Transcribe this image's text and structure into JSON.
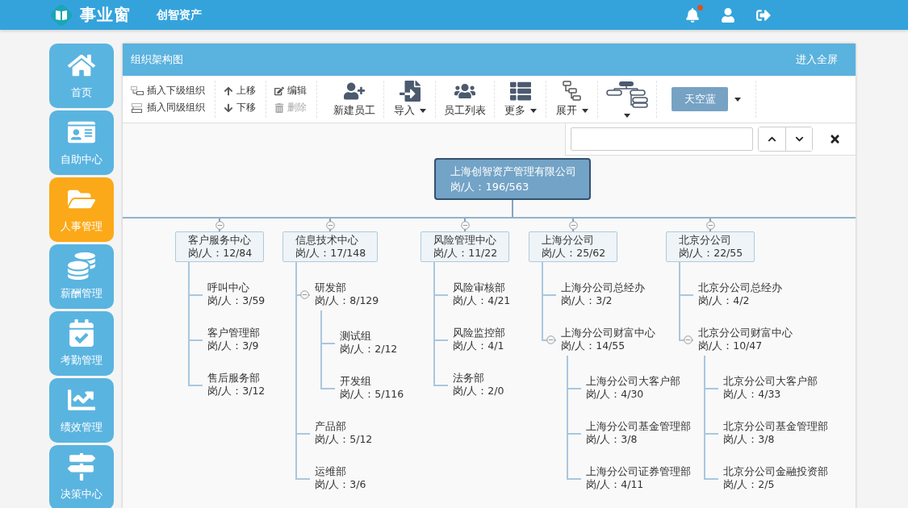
{
  "header": {
    "logo": "事业窗",
    "company": "创智资产",
    "notification_dot": true
  },
  "sidebar": {
    "items": [
      {
        "label": "首页",
        "selected": false
      },
      {
        "label": "自助中心",
        "selected": false
      },
      {
        "label": "人事管理",
        "selected": true
      },
      {
        "label": "薪酬管理",
        "selected": false
      },
      {
        "label": "考勤管理",
        "selected": false
      },
      {
        "label": "绩效管理",
        "selected": false
      },
      {
        "label": "决策中心",
        "selected": false
      }
    ]
  },
  "panel": {
    "title": "组织架构图",
    "fullscreen_link": "进入全屏"
  },
  "toolbar": {
    "small_groups": [
      [
        {
          "label": "插入下级组织",
          "disabled": false
        },
        {
          "label": "插入同级组织",
          "disabled": false
        }
      ],
      [
        {
          "label": "上移",
          "disabled": false
        },
        {
          "label": "下移",
          "disabled": false
        }
      ],
      [
        {
          "label": "编辑",
          "disabled": false
        },
        {
          "label": "删除",
          "disabled": true
        }
      ]
    ],
    "large_buttons": [
      {
        "label": "新建员工",
        "dropdown": false
      },
      {
        "label": "导入",
        "dropdown": true
      },
      {
        "label": "员工列表",
        "dropdown": false
      },
      {
        "label": "更多",
        "dropdown": true
      },
      {
        "label": "展开",
        "dropdown": true
      },
      {
        "dropdown": true
      }
    ],
    "theme_button": {
      "label": "天空蓝"
    }
  },
  "org_chart": {
    "root": {
      "name": "上海创智资产管理有限公司",
      "count": "岗/人：196/563"
    },
    "departments": [
      {
        "name": "客户服务中心",
        "count": "岗/人：12/84",
        "expanded": true,
        "children": [
          {
            "name": "呼叫中心",
            "count": "岗/人：3/59"
          },
          {
            "name": "客户管理部",
            "count": "岗/人：3/9"
          },
          {
            "name": "售后服务部",
            "count": "岗/人：3/12"
          }
        ]
      },
      {
        "name": "信息技术中心",
        "count": "岗/人：17/148",
        "expanded": true,
        "children": [
          {
            "name": "研发部",
            "count": "岗/人：8/129",
            "expanded": true,
            "children": [
              {
                "name": "测试组",
                "count": "岗/人：2/12"
              },
              {
                "name": "开发组",
                "count": "岗/人：5/116"
              }
            ]
          },
          {
            "name": "产品部",
            "count": "岗/人：5/12"
          },
          {
            "name": "运维部",
            "count": "岗/人：3/6"
          }
        ]
      },
      {
        "name": "风险管理中心",
        "count": "岗/人：11/22",
        "expanded": true,
        "children": [
          {
            "name": "风险审核部",
            "count": "岗/人：4/21"
          },
          {
            "name": "风险监控部",
            "count": "岗/人：4/1"
          },
          {
            "name": "法务部",
            "count": "岗/人：2/0"
          }
        ]
      },
      {
        "name": "上海分公司",
        "count": "岗/人：25/62",
        "expanded": true,
        "children": [
          {
            "name": "上海分公司总经办",
            "count": "岗/人：3/2"
          },
          {
            "name": "上海分公司财富中心",
            "count": "岗/人：14/55",
            "expanded": true,
            "children": [
              {
                "name": "上海分公司大客户部",
                "count": "岗/人：4/30"
              },
              {
                "name": "上海分公司基金管理部",
                "count": "岗/人：3/8"
              },
              {
                "name": "上海分公司证券管理部",
                "count": "岗/人：4/11"
              }
            ]
          }
        ]
      },
      {
        "name": "北京分公司",
        "count": "岗/人：22/55",
        "expanded": true,
        "children": [
          {
            "name": "北京分公司总经办",
            "count": "岗/人：4/2"
          },
          {
            "name": "北京分公司财富中心",
            "count": "岗/人：10/47",
            "expanded": true,
            "children": [
              {
                "name": "北京分公司大客户部",
                "count": "岗/人：4/33"
              },
              {
                "name": "北京分公司基金管理部",
                "count": "岗/人：3/8"
              },
              {
                "name": "北京分公司金融投资部",
                "count": "岗/人：2/5"
              }
            ]
          }
        ]
      }
    ]
  }
}
